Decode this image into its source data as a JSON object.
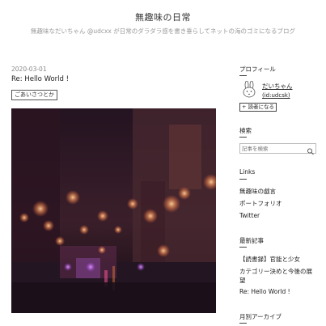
{
  "blog": {
    "title": "無趣味の日常",
    "description": "無趣味なだいちゃん @udcxx が日常のダラダラ感を書き垂らしてネットの海のゴミになるブログ"
  },
  "entry": {
    "date": "2020-03-01",
    "title": "Re: Hello World !",
    "category": "ごあいさつとか"
  },
  "sidebar": {
    "profile": {
      "heading": "プロフィール",
      "name": "だいちゃん",
      "id": "(id:udcsk)",
      "reader_button": "+ 読者になる",
      "avatar_icon": "rabbit-icon"
    },
    "search": {
      "heading": "検索",
      "placeholder": "記事を検索",
      "icon": "search-icon"
    },
    "links": {
      "heading": "Links",
      "items": [
        "無趣味の戯言",
        "ポートフォリオ",
        "Twitter"
      ]
    },
    "recent": {
      "heading": "最新記事",
      "items": [
        "【読書録】官能と少女",
        "カテゴリー決めと今後の展",
        "望",
        "Re: Hello World !"
      ]
    },
    "archive": {
      "heading": "月別アーカイブ"
    }
  },
  "colors": {
    "text": "#333333",
    "muted": "#999999",
    "photo_background": "#1a0f1d"
  }
}
